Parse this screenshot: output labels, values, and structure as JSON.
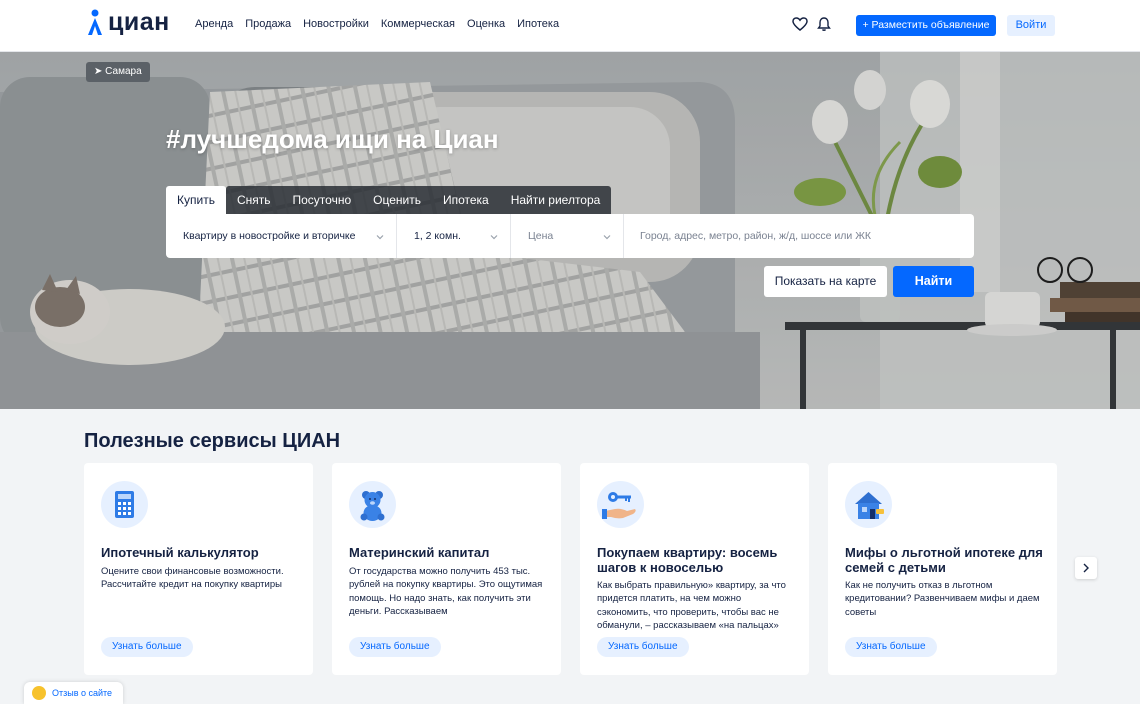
{
  "header": {
    "logo_text": "циан",
    "nav": [
      "Аренда",
      "Продажа",
      "Новостройки",
      "Коммерческая",
      "Оценка",
      "Ипотека"
    ],
    "place_ad": "+ Разместить объявление",
    "login": "Войти",
    "icons": [
      "heart-icon",
      "bell-icon"
    ]
  },
  "hero": {
    "city": "Самара",
    "title": "#лучшедома ищи на Циан",
    "tabs": [
      "Купить",
      "Снять",
      "Посуточно",
      "Оценить",
      "Ипотека",
      "Найти риелтора"
    ],
    "active_tab": "Купить",
    "search": {
      "type": "Квартиру в новостройке и вторичке",
      "rooms": "1, 2 комн.",
      "price": "Цена",
      "address_placeholder": "Город, адрес, метро, район, ж/д, шоссе или ЖК"
    },
    "show_on_map": "Показать на карте",
    "find": "Найти"
  },
  "services": {
    "title": "Полезные сервисы ЦИАН",
    "cards": [
      {
        "icon": "calculator-icon",
        "title": "Ипотечный калькулятор",
        "desc": "Оцените свои финансовые возможности. Рассчитайте кредит на покупку квартиры",
        "button": "Узнать больше"
      },
      {
        "icon": "teddy-bear-icon",
        "title": "Материнский капитал",
        "desc": "От государства можно получить 453 тыс. рублей на покупку квартиры. Это ощутимая помощь. Но надо знать, как получить эти деньги. Рассказываем",
        "button": "Узнать больше"
      },
      {
        "icon": "key-hand-icon",
        "title": "Покупаем квартиру: восемь шагов к новоселью",
        "desc": "Как выбрать правильную» квартиру, за что придется платить, на чем можно сэкономить, что проверить, чтобы вас не обманули, – рассказываем «на пальцах»",
        "button": "Узнать больше"
      },
      {
        "icon": "house-icon",
        "title": "Мифы о льготной ипотеке для семей с детьми",
        "desc": "Как не получить отказ в льготном кредитовании? Развенчиваем мифы и даем советы",
        "button": "Узнать больше"
      }
    ]
  },
  "feedback": "Отзыв о сайте",
  "colors": {
    "accent": "#0468ff",
    "text": "#152242",
    "light_accent": "#e6f0ff"
  }
}
